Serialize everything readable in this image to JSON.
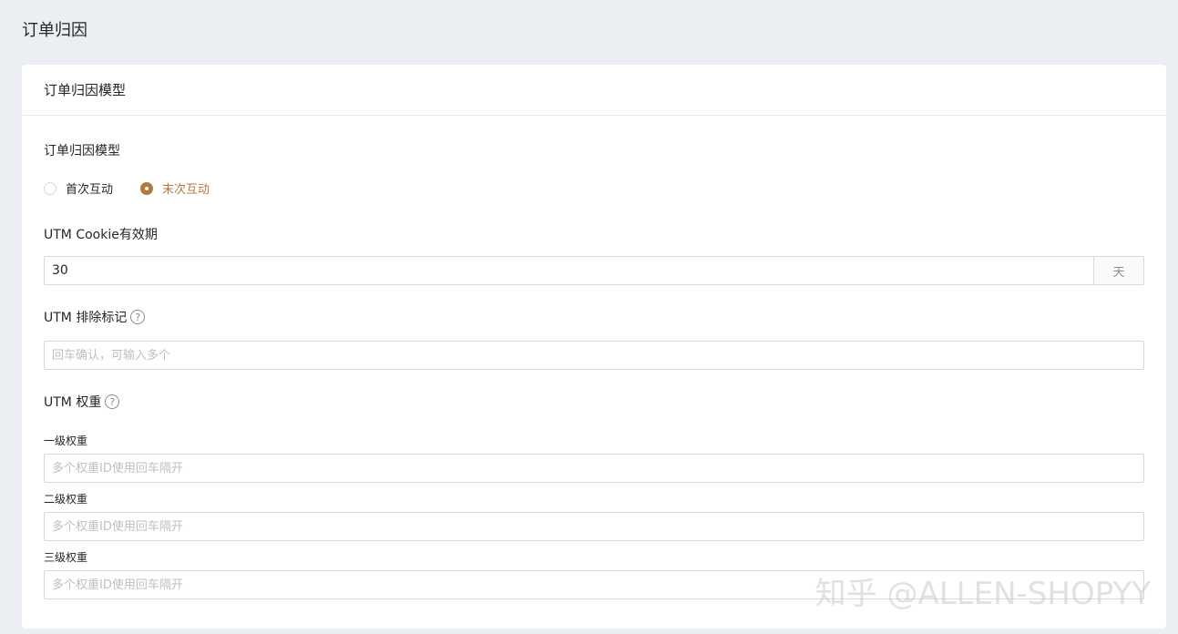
{
  "page": {
    "title": "订单归因"
  },
  "card": {
    "title": "订单归因模型"
  },
  "attribution_model": {
    "label": "订单归因模型",
    "options": [
      {
        "label": "首次互动",
        "checked": false
      },
      {
        "label": "末次互动",
        "checked": true
      }
    ]
  },
  "cookie": {
    "label": "UTM Cookie有效期",
    "value": "30",
    "unit": "天"
  },
  "exclude": {
    "label": "UTM 排除标记",
    "help": "?",
    "placeholder": "回车确认，可输入多个"
  },
  "weight": {
    "label": "UTM 权重",
    "help": "?",
    "levels": [
      {
        "label": "一级权重",
        "placeholder": "多个权重ID使用回车隔开"
      },
      {
        "label": "二级权重",
        "placeholder": "多个权重ID使用回车隔开"
      },
      {
        "label": "三级权重",
        "placeholder": "多个权重ID使用回车隔开"
      }
    ]
  },
  "watermark": "知乎 @ALLEN-SHOPYY",
  "colors": {
    "accent": "#b07a3e",
    "background": "#ebeef3"
  }
}
